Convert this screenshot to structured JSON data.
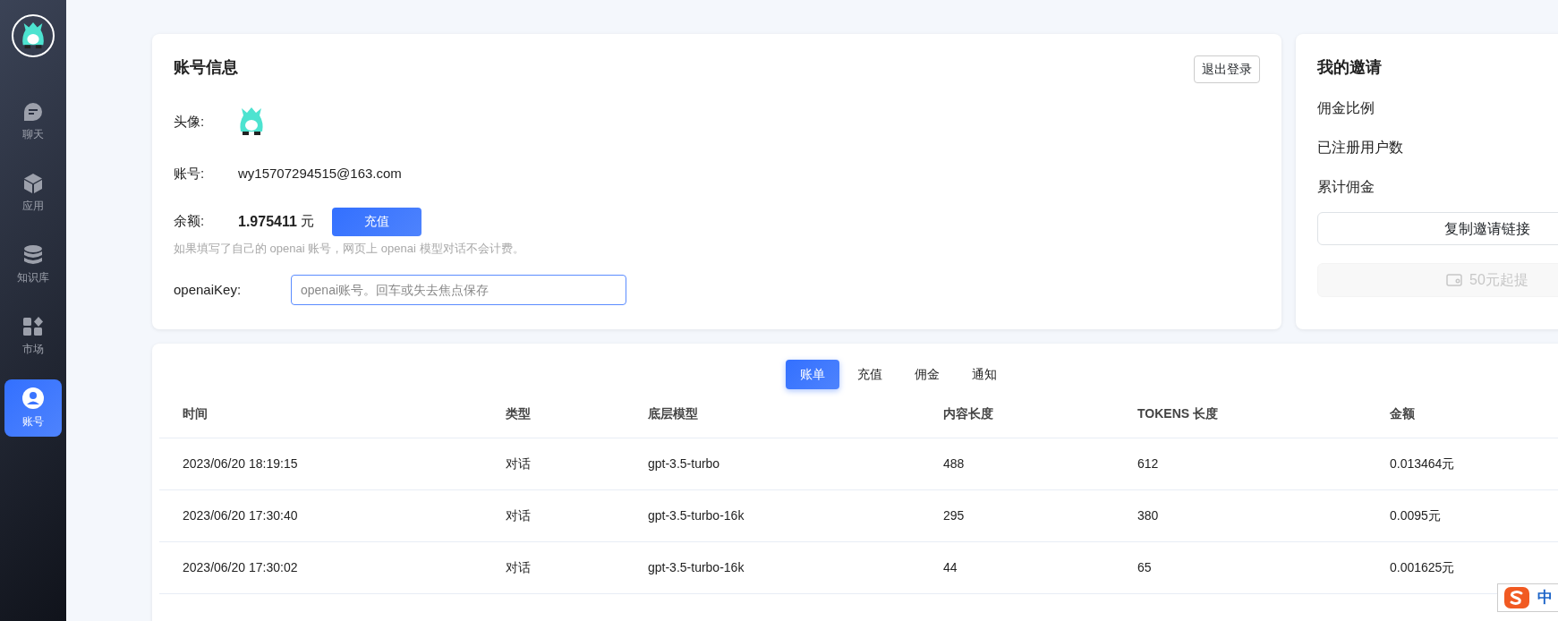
{
  "sidebar": {
    "items": [
      {
        "label": "聊天",
        "selected": false
      },
      {
        "label": "应用",
        "selected": false
      },
      {
        "label": "知识库",
        "selected": false
      },
      {
        "label": "市场",
        "selected": false
      },
      {
        "label": "账号",
        "selected": true
      }
    ]
  },
  "account": {
    "title": "账号信息",
    "logout_button": "退出登录",
    "avatar_label": "头像:",
    "account_label": "账号:",
    "account_value": "wy15707294515@163.com",
    "balance_label": "余额:",
    "balance_value": "1.975411",
    "balance_unit": "元",
    "recharge_button": "充值",
    "hint": "如果填写了自己的 openai 账号，网页上 openai 模型对话不会计费。",
    "key_label": "openaiKey:",
    "key_field": {
      "placeholder": "openai账号。回车或失去焦点保存"
    }
  },
  "invite": {
    "title": "我的邀请",
    "stats": [
      "佣金比例",
      "已注册用户数",
      "累计佣金"
    ],
    "copy_button": "复制邀请链接",
    "withdraw_button": {
      "label": "50元起提",
      "disabled": true
    }
  },
  "records": {
    "tabs": [
      {
        "label": "账单",
        "selected": true
      },
      {
        "label": "充值",
        "selected": false
      },
      {
        "label": "佣金",
        "selected": false
      },
      {
        "label": "通知",
        "selected": false
      }
    ],
    "table": {
      "columns": [
        "时间",
        "类型",
        "底层模型",
        "内容长度",
        "TOKENS 长度",
        "金额"
      ],
      "rows": [
        [
          "2023/06/20 18:19:15",
          "对话",
          "gpt-3.5-turbo",
          "488",
          "612",
          "0.013464元"
        ],
        [
          "2023/06/20 17:30:40",
          "对话",
          "gpt-3.5-turbo-16k",
          "295",
          "380",
          "0.0095元"
        ],
        [
          "2023/06/20 17:30:02",
          "对话",
          "gpt-3.5-turbo-16k",
          "44",
          "65",
          "0.001625元"
        ]
      ]
    }
  },
  "ime": {
    "label": "中"
  }
}
